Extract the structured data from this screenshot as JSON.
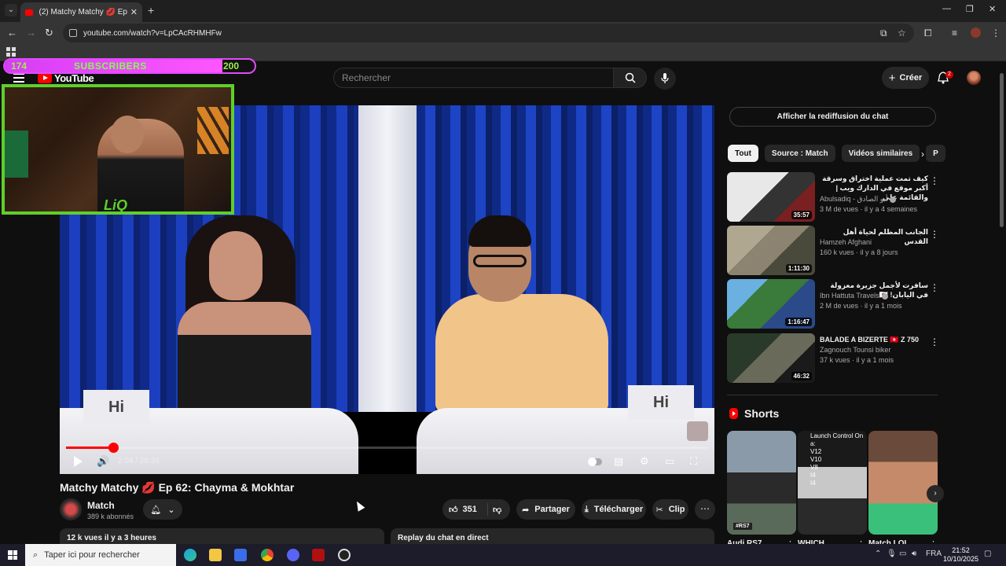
{
  "browser": {
    "tab_title": "(2) Matchy Matchy 💋 Ep 62: Ch",
    "url": "youtube.com/watch?v=LpCAcRHMHFw"
  },
  "youtube": {
    "logo_text": "YouTube",
    "search_placeholder": "Rechercher",
    "create_label": "Créer",
    "notification_count": "2"
  },
  "overlay": {
    "sub_current": "174",
    "sub_label": "SUBSCRIBERS",
    "sub_goal": "200",
    "sub_progress": 0.87,
    "cam_logo": "LiQ"
  },
  "player": {
    "sign_left": "Hi",
    "sign_right": "Hi",
    "time": "2:04 / 28:24",
    "progress": 0.073
  },
  "video": {
    "title": "Matchy Matchy 💋 Ep 62: Chayma & Mokhtar",
    "channel_name": "Match",
    "channel_subs": "389 k abonnés",
    "likes": "351",
    "share_label": "Partager",
    "download_label": "Télécharger",
    "clip_label": "Clip",
    "views_date": "12 k vues  il y a 3 heures",
    "chat_replay_label": "Replay du chat en direct"
  },
  "sidebar": {
    "chat_replay_button": "Afficher la rediffusion du chat",
    "chips": [
      "Tout",
      "Source : Match",
      "Vidéos similaires",
      "P"
    ],
    "recommendations": [
      {
        "title": "كيف تمت عملية اختراق وسرقة أكبر موقع في الدارك ويب | والقائمة على",
        "channel": "Abulsadiq - أبو الصادق",
        "verified": true,
        "meta": "3 M de vues · il y a 4 semaines",
        "duration": "35:57"
      },
      {
        "title": "الجانب المظلم لحياة أهل القدس",
        "channel": "Hamzeh Afghani",
        "verified": false,
        "meta": "160 k vues · il y a 8 jours",
        "duration": "1:11:30"
      },
      {
        "title": "سافرت لأجمل جزيرة معزولة في اليابان! 🇯🇵",
        "channel": "Ibn Hattuta Travels",
        "verified": true,
        "meta": "2 M de vues · il y a 1 mois",
        "duration": "1:16:47"
      },
      {
        "title": "BALADE A BIZERTE 🇹🇳 Z 750",
        "channel": "Zagnouch Tounsi biker",
        "verified": false,
        "meta": "37 k vues · il y a 1 mois",
        "duration": "46:32"
      }
    ],
    "shorts_heading": "Shorts",
    "shorts": [
      {
        "title": "Audi RS7",
        "tag": "#RS7"
      },
      {
        "title": "WHICH",
        "overlay": "Launch Control On a:\nV12\nV10\nV8\nI4\nI4"
      },
      {
        "title": "Match LOL"
      }
    ]
  },
  "taskbar": {
    "search_placeholder": "Taper ici pour rechercher",
    "lang": "FRA",
    "time": "21:52",
    "date": "10/10/2025"
  }
}
